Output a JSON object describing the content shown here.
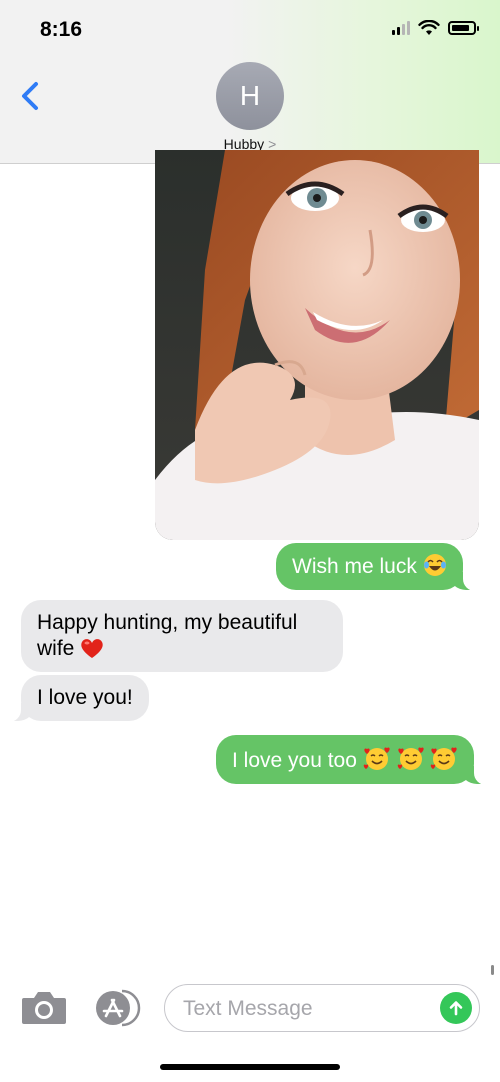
{
  "status_bar": {
    "time": "8:16"
  },
  "header": {
    "avatar_initial": "H",
    "contact_name": "Hubby",
    "contact_chevron": ">"
  },
  "messages": [
    {
      "direction": "sent",
      "type": "photo"
    },
    {
      "direction": "sent",
      "text": "Wish me luck",
      "emoji": "tears-of-joy-emoji"
    },
    {
      "direction": "received",
      "text": "Happy hunting, my beautiful wife",
      "emoji": "red-heart-emoji"
    },
    {
      "direction": "received",
      "text": "I love you!"
    },
    {
      "direction": "sent",
      "text": "I love you too",
      "emoji": "smiling-face-with-hearts-emoji x3"
    }
  ],
  "input": {
    "placeholder": "Text Message"
  },
  "colors": {
    "sent_bubble": "#65c466",
    "received_bubble": "#e9e9eb",
    "accent_blue": "#2f7cf6",
    "send_button": "#34c759"
  }
}
